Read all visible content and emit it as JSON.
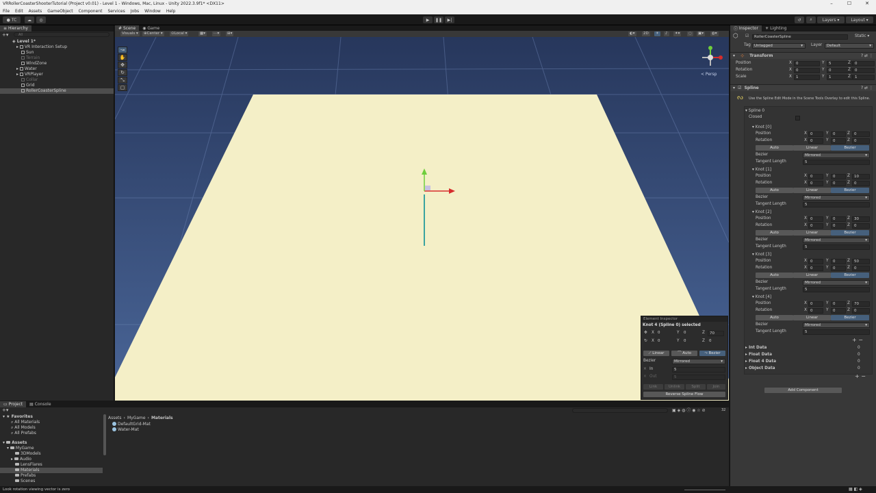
{
  "window": {
    "title": "VRRollerCoasterShooterTutorial (Project v0.01) - Level 1 - Windows, Mac, Linux - Unity 2022.3.9f1* <DX11>"
  },
  "menu": [
    "File",
    "Edit",
    "Assets",
    "GameObject",
    "Component",
    "Services",
    "Jobs",
    "Window",
    "Help"
  ],
  "toolbar": {
    "account": "TC",
    "layers": "Layers",
    "layout": "Layout"
  },
  "hierarchy": {
    "tab": "Hierarchy",
    "search_placeholder": "All",
    "scene": "Level 1*",
    "items": [
      "VR Interaction Setup",
      "Sun",
      "Terrain",
      "WindZone",
      "Water",
      "VRPlayer",
      "Collar",
      "Grid",
      "RollerCoasterSpline"
    ]
  },
  "scene": {
    "tabs": [
      "Scene",
      "Game"
    ],
    "visuals": "Visuals",
    "pivot": "Center",
    "space": "Local",
    "mode2d": "2D",
    "persp": "< Persp"
  },
  "element_inspector": {
    "title": "Element Inspector",
    "selected": "Knot 4 (Spline 0) selected",
    "pos": {
      "x": "0",
      "y": "0",
      "z": "70"
    },
    "rot": {
      "x": "0",
      "y": "0",
      "z": "0"
    },
    "modes": [
      "Linear",
      "Auto",
      "Bezier"
    ],
    "bezier_label": "Bezier",
    "bezier_value": "Mirrored",
    "in_label": "In",
    "in_value": "5",
    "out_label": "Out",
    "out_value": "5",
    "actions": [
      "Link",
      "Unlink",
      "Split",
      "Join"
    ],
    "reverse": "Reverse Spline Flow"
  },
  "inspector": {
    "tabs": [
      "Inspector",
      "Lighting"
    ],
    "object_name": "RollerCoasterSpline",
    "static": "Static",
    "tag_label": "Tag",
    "tag": "Untagged",
    "layer_label": "Layer",
    "layer": "Default",
    "transform": {
      "title": "Transform",
      "rows": [
        {
          "label": "Position",
          "x": "0",
          "y": "5",
          "z": "0"
        },
        {
          "label": "Rotation",
          "x": "0",
          "y": "0",
          "z": "0"
        },
        {
          "label": "Scale",
          "x": "1",
          "y": "1",
          "z": "1"
        }
      ]
    },
    "spline": {
      "title": "Spline",
      "hint": "Use the Spline Edit Mode in the Scene Tools Overlay to edit this Spline.",
      "spline_label": "Spline 0",
      "closed": "Closed",
      "knots": [
        {
          "name": "Knot [0]",
          "px": "0",
          "py": "0",
          "pz": "0",
          "rx": "0",
          "ry": "0",
          "rz": "0",
          "bezier": "Mirrored",
          "tangent": "5"
        },
        {
          "name": "Knot [1]",
          "px": "0",
          "py": "0",
          "pz": "10",
          "rx": "0",
          "ry": "0",
          "rz": "0",
          "bezier": "Mirrored",
          "tangent": "5"
        },
        {
          "name": "Knot [2]",
          "px": "0",
          "py": "0",
          "pz": "30",
          "rx": "0",
          "ry": "0",
          "rz": "0",
          "bezier": "Mirrored",
          "tangent": "5"
        },
        {
          "name": "Knot [3]",
          "px": "0",
          "py": "0",
          "pz": "50",
          "rx": "0",
          "ry": "0",
          "rz": "0",
          "bezier": "Mirrored",
          "tangent": "5"
        },
        {
          "name": "Knot [4]",
          "px": "0",
          "py": "0",
          "pz": "70",
          "rx": "0",
          "ry": "0",
          "rz": "0",
          "bezier": "Mirrored",
          "tangent": "5"
        }
      ],
      "labels": {
        "position": "Position",
        "rotation": "Rotation",
        "bezier": "Bezier",
        "tangent": "Tangent Length",
        "auto": "Auto",
        "linear": "Linear",
        "bez": "Bezier"
      },
      "data": [
        {
          "label": "Int Data",
          "value": "0"
        },
        {
          "label": "Float Data",
          "value": "0"
        },
        {
          "label": "Float 4 Data",
          "value": "0"
        },
        {
          "label": "Object Data",
          "value": "0"
        }
      ]
    },
    "add_component": "Add Component"
  },
  "project": {
    "tabs": [
      "Project",
      "Console"
    ],
    "favorites_label": "Favorites",
    "favorites": [
      "All Materials",
      "All Models",
      "All Prefabs"
    ],
    "assets_label": "Assets",
    "tree": [
      "MyGame",
      "3DModels",
      "Audio",
      "LensFlares",
      "Materials",
      "Prefabs",
      "Scenes"
    ],
    "breadcrumb": [
      "Assets",
      "MyGame",
      "Materials"
    ],
    "files": [
      "DefaultGrid-Mat",
      "Water-Mat"
    ],
    "count": "32"
  },
  "status": "Look rotation viewing vector is zero"
}
